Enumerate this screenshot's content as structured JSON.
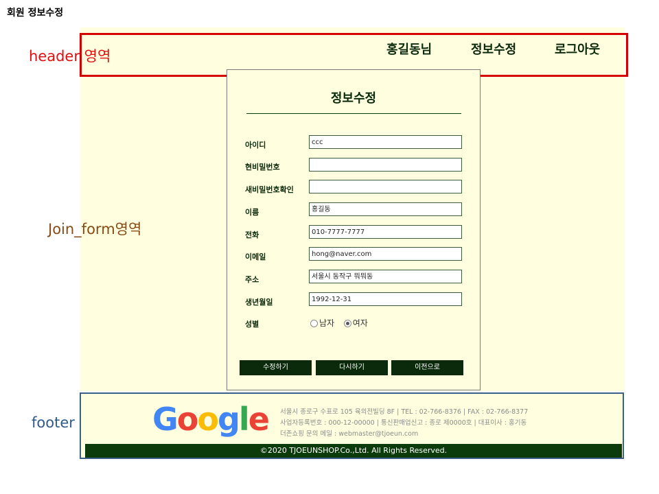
{
  "page_title": "회원 정보수정",
  "annotations": {
    "header": "header 영역",
    "join": "Join_form영역",
    "footer": "footer 영역"
  },
  "nav": [
    "홍길동님",
    "정보수정",
    "로그아웃"
  ],
  "form": {
    "title": "정보수정",
    "fields": [
      {
        "label": "아이디",
        "value": ""
      },
      {
        "label": "현비밀번호",
        "value": ""
      },
      {
        "label": "새비밀번호확인",
        "value": ""
      },
      {
        "label": "이름",
        "value": "홍길동"
      },
      {
        "label": "전화",
        "value": "010-7777-7777"
      },
      {
        "label": "이메일",
        "value": "hong@naver.com"
      },
      {
        "label": "주소",
        "value": "서울시 동작구 뭐뭐동"
      },
      {
        "label": "생년월일",
        "value": "1992-12-31"
      }
    ],
    "id_value": "ccc",
    "gender_label": "성별",
    "gender_options": [
      "남자",
      "여자"
    ],
    "gender_selected": "여자",
    "buttons": [
      "수정하기",
      "다시하기",
      "이전으로"
    ]
  },
  "footer": {
    "logo_letters": [
      "G",
      "o",
      "o",
      "g",
      "l",
      "e"
    ],
    "logo_colors": [
      "#4285F4",
      "#EA4335",
      "#FBBC05",
      "#4285F4",
      "#34A853",
      "#EA4335"
    ],
    "info_lines": [
      "서울시 종로구 수표로 105 육의전빌딩 8F | TEL : 02-766-8376 | FAX : 02-766-8377",
      "사업자등록번호 : 000-12-00000 | 통신판매업신고 : 종로 제0000호 | 대표이사 : 홍기동",
      "더존쇼핑 문의 메일 : webmaster@tjoeun.com"
    ],
    "copyright": "©2020 TJOEUNSHOP.Co.,Ltd. All Rights Reserved."
  }
}
